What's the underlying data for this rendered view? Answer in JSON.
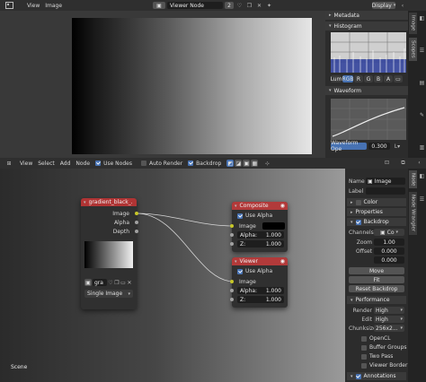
{
  "image_editor": {
    "menu": [
      "View",
      "Image"
    ],
    "image_name": "Viewer Node",
    "users": "2",
    "display_label": "Display"
  },
  "sidebar_image": {
    "metadata_label": "Metadata",
    "histogram_label": "Histogram",
    "channels": [
      "Lum",
      "RGB",
      "R",
      "G",
      "B",
      "A"
    ],
    "active_channel": "RGB",
    "waveform_label": "Waveform",
    "waveform_mode": "Waveform Ope",
    "waveform_value": "0.300",
    "tabs": [
      "Image",
      "Scopes"
    ]
  },
  "node_editor": {
    "menu": [
      "View",
      "Select",
      "Add",
      "Node"
    ],
    "use_nodes_label": "Use Nodes",
    "auto_render_label": "Auto Render",
    "backdrop_label": "Backdrop",
    "scene_label": "Scene"
  },
  "node_image": {
    "title": "gradient_black_...",
    "outputs": [
      "Image",
      "Alpha",
      "Depth"
    ],
    "image_field": "gra",
    "source": "Single Image"
  },
  "node_composite": {
    "title": "Composite",
    "use_alpha": "Use Alpha",
    "inputs": [
      "Image",
      "Alpha:",
      "Z:"
    ],
    "alpha_value": "1.000",
    "z_value": "1.000"
  },
  "node_viewer": {
    "title": "Viewer",
    "use_alpha": "Use Alpha",
    "inputs": [
      "Image",
      "Alpha:",
      "Z:"
    ],
    "alpha_value": "1.000",
    "z_value": "1.000"
  },
  "node_sidebar": {
    "name_label": "Name",
    "name_value": "Image",
    "label_label": "Label",
    "color_label": "Color",
    "properties_label": "Properties",
    "backdrop_label": "Backdrop",
    "channels_label": "Channels",
    "channels_value": "Co",
    "zoom_label": "Zoom",
    "zoom_value": "1.00",
    "offset_label": "Offset",
    "offset_x": "0.000",
    "offset_y": "0.000",
    "move_label": "Move",
    "fit_label": "Fit",
    "reset_label": "Reset Backdrop",
    "performance_label": "Performance",
    "render_label": "Render",
    "render_value": "High",
    "edit_label": "Edit",
    "edit_value": "High",
    "chunksize_label": "Chunksize",
    "chunksize_value": "256x2...",
    "opencl_label": "OpenCL",
    "buffer_groups_label": "Buffer Groups",
    "two_pass_label": "Two Pass",
    "viewer_border_label": "Viewer Border",
    "annotations_label": "Annotations",
    "tabs": [
      "Node",
      "Node Wrangler"
    ]
  },
  "colors": {
    "accent_blue": "#4772b3",
    "node_header_input": "#c43c3c",
    "node_header_output": "#b23a3a",
    "socket_yellow": "#c7c729",
    "socket_gray": "#a1a1a1"
  }
}
